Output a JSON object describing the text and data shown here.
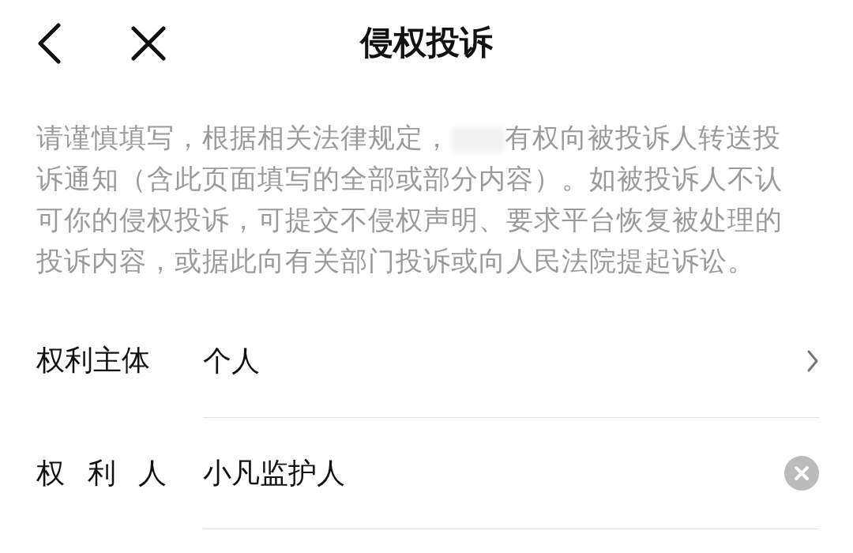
{
  "header": {
    "title": "侵权投诉"
  },
  "notice": {
    "before_redaction": "请谨慎填写，根据相关法律规定，",
    "after_redaction": "有权向被投诉人转送投诉通知（含此页面填写的全部或部分内容）。如被投诉人不认可你的侵权投诉，可提交不侵权声明、要求平台恢复被处理的投诉内容，或据此向有关部门投诉或向人民法院提起诉讼。"
  },
  "fields": [
    {
      "kind": "select",
      "label": "权利主体",
      "value": "个人"
    },
    {
      "kind": "text",
      "label": "权利人",
      "value": "小凡监护人"
    }
  ]
}
